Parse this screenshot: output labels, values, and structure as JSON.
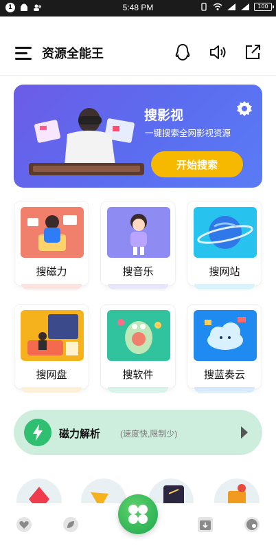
{
  "status_bar": {
    "time": "5:48 PM",
    "notification_count": "1",
    "battery": "100"
  },
  "header": {
    "title": "资源全能王",
    "icons": [
      "menu-icon",
      "qq-penguin-icon",
      "speaker-icon",
      "share-external-icon"
    ]
  },
  "banner": {
    "title": "搜影视",
    "subtitle": "一键搜索全网影视资源",
    "button_label": "开始搜索",
    "colors": {
      "start": "#6c5ce7",
      "end": "#5a7cf5",
      "button": "#f7b800"
    }
  },
  "tiles_row1": [
    {
      "label": "搜磁力",
      "bg": "#f0806c",
      "shade": "#fde3df"
    },
    {
      "label": "搜音乐",
      "bg": "#8e8cf2",
      "shade": "#e7e7fb"
    },
    {
      "label": "搜网站",
      "bg": "#27c3ee",
      "shade": "#d8f3fb"
    }
  ],
  "tiles_row2": [
    {
      "label": "搜网盘",
      "bg": "#f5b21c",
      "shade": "#fdf0d6"
    },
    {
      "label": "搜软件",
      "bg": "#30c39e",
      "shade": "#d7f3ea"
    },
    {
      "label": "搜蓝奏云",
      "bg": "#1f8bf0",
      "shade": "#d7e9fc"
    }
  ],
  "magnet": {
    "title": "磁力解析",
    "subtitle": "(速度快,限制少)",
    "color": "#cdeedd"
  },
  "tabbar": {
    "icons": [
      "heart-icon",
      "leaf-icon",
      "clover-icon",
      "download-box-icon",
      "profile-icon"
    ]
  }
}
